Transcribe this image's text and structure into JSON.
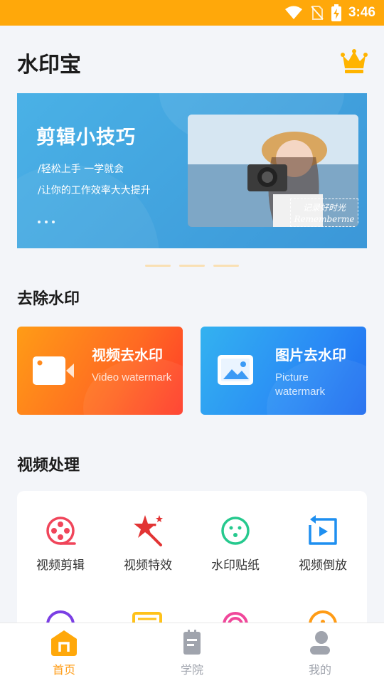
{
  "status_bar": {
    "time": "3:46"
  },
  "header": {
    "app_title": "水印宝"
  },
  "banner": {
    "title": "剪辑小技巧",
    "line1": "/轻松上手 一学就会",
    "line2": "/让你的工作效率大大提升",
    "photo_caption_top": "记录好时光",
    "photo_caption_bottom": "Rememberme"
  },
  "sections": {
    "remove_watermark": "去除水印",
    "video_processing": "视频处理"
  },
  "cards": {
    "video": {
      "title": "视频去水印",
      "subtitle": "Video watermark"
    },
    "photo": {
      "title": "图片去水印",
      "subtitle": "Picture watermark"
    }
  },
  "tools": [
    {
      "label": "视频剪辑",
      "icon": "film-reel-icon",
      "color": "#f0455a"
    },
    {
      "label": "视频特效",
      "icon": "magic-star-icon",
      "color": "#e23434"
    },
    {
      "label": "水印贴纸",
      "icon": "smiley-sticker-icon",
      "color": "#26c98e"
    },
    {
      "label": "视频倒放",
      "icon": "reverse-play-icon",
      "color": "#1e8ff0"
    }
  ],
  "tools_row2_icons": [
    {
      "icon": "purple-tool-icon",
      "color": "#7b3fe4"
    },
    {
      "icon": "yellow-tool-icon",
      "color": "#ffc21a"
    },
    {
      "icon": "pink-tool-icon",
      "color": "#f0479a"
    },
    {
      "icon": "orange-tool-icon",
      "color": "#ff9c16"
    }
  ],
  "bottom_nav": [
    {
      "label": "首页",
      "icon": "home-icon",
      "active": true
    },
    {
      "label": "学院",
      "icon": "academy-notebook-icon",
      "active": false
    },
    {
      "label": "我的",
      "icon": "profile-icon",
      "active": false
    }
  ],
  "colors": {
    "accent": "#ffa80a",
    "active_nav": "#ff9c16",
    "inactive_nav": "#a0a4ad"
  }
}
